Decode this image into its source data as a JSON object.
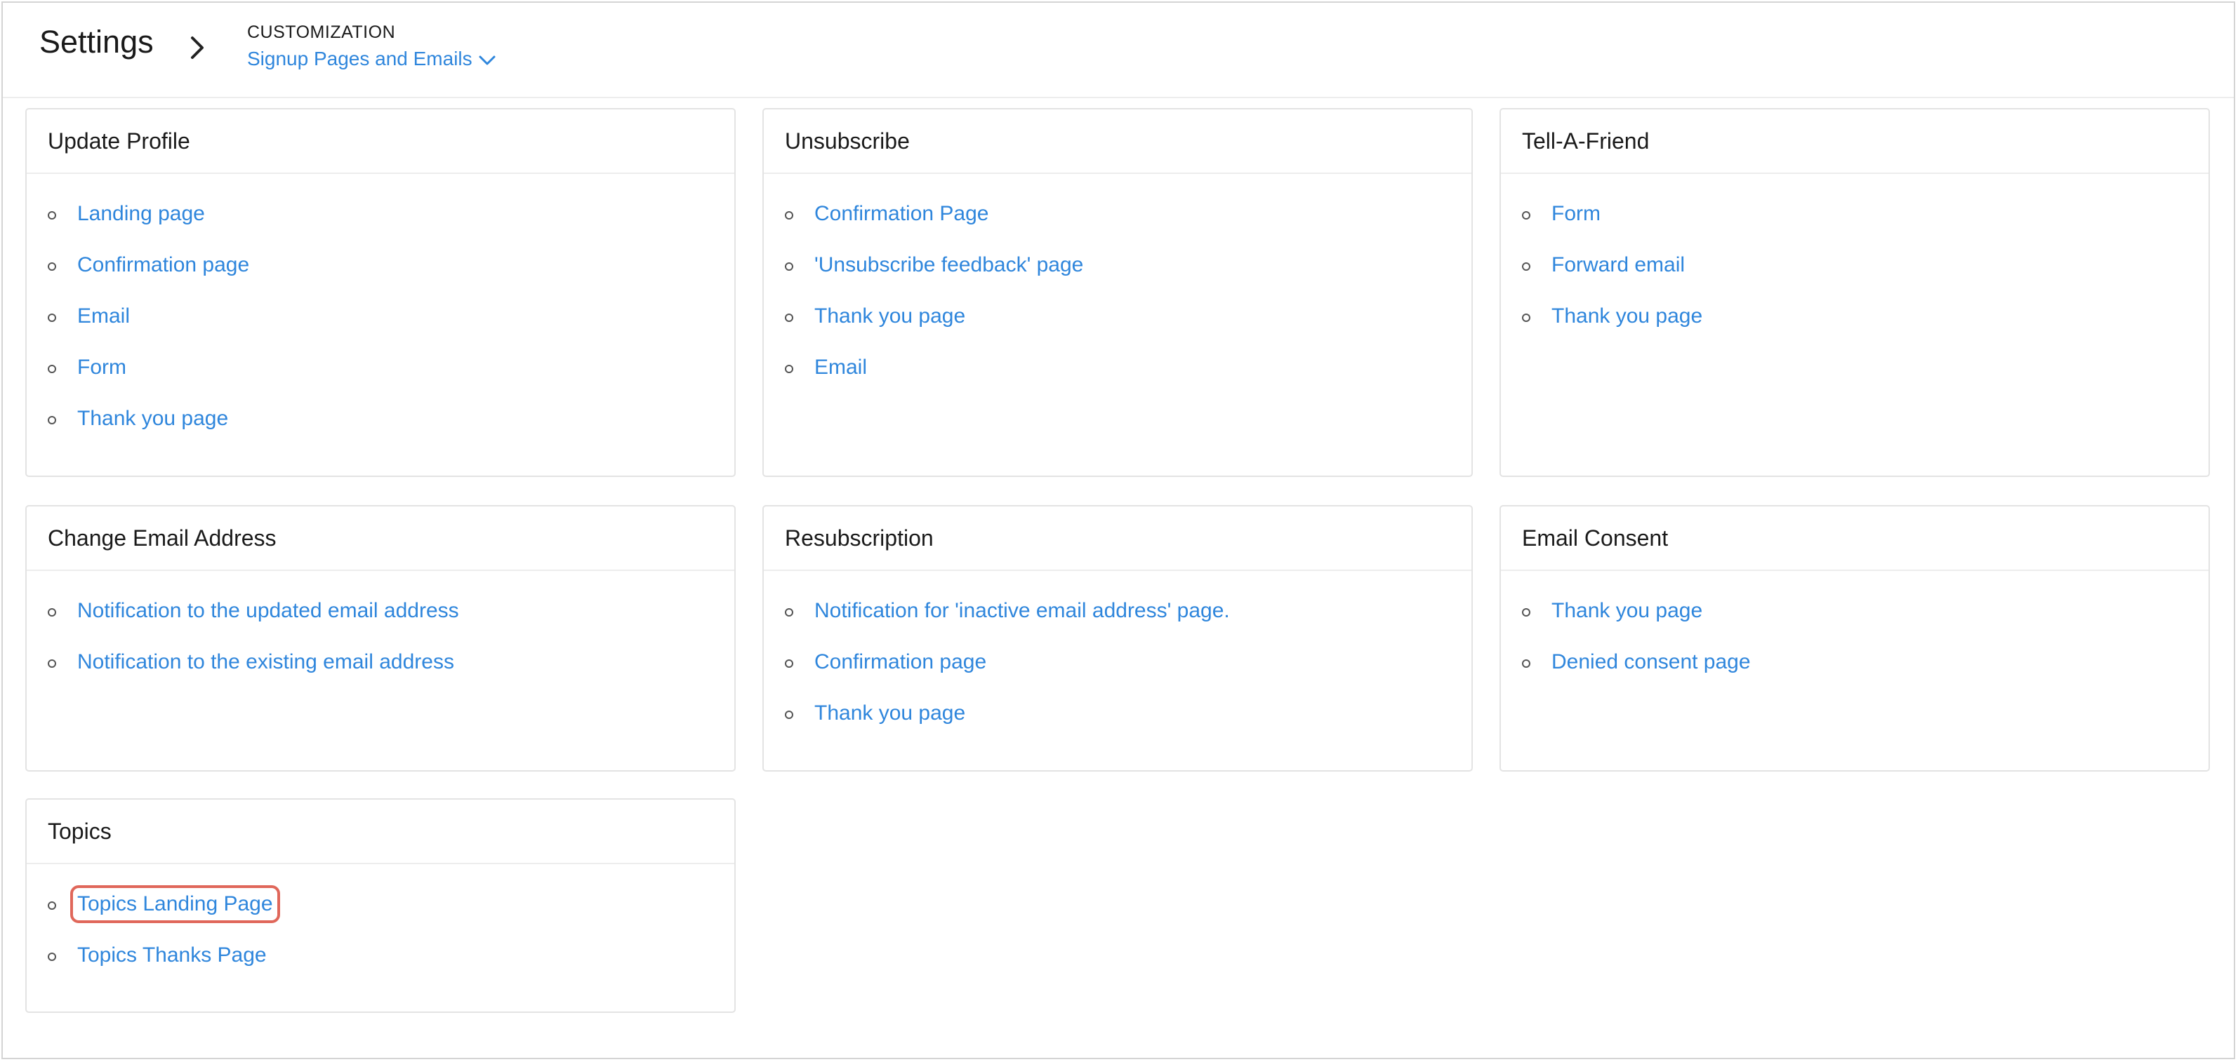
{
  "header": {
    "title": "Settings",
    "breadcrumb_section": "CUSTOMIZATION",
    "breadcrumb_page": "Signup Pages and Emails"
  },
  "cards": [
    {
      "title": "Update Profile",
      "items": [
        "Landing page",
        "Confirmation page",
        "Email",
        "Form",
        "Thank you page"
      ]
    },
    {
      "title": "Unsubscribe",
      "items": [
        "Confirmation Page",
        "'Unsubscribe feedback' page",
        "Thank you page",
        "Email"
      ]
    },
    {
      "title": "Tell-A-Friend",
      "items": [
        "Form",
        "Forward email",
        "Thank you page"
      ]
    },
    {
      "title": "Change Email Address",
      "items": [
        "Notification to the updated email address",
        "Notification to the existing email address"
      ]
    },
    {
      "title": "Resubscription",
      "items": [
        "Notification for 'inactive email address' page.",
        "Confirmation page",
        "Thank you page"
      ]
    },
    {
      "title": "Email Consent",
      "items": [
        "Thank you page",
        "Denied consent page"
      ]
    },
    {
      "title": "Topics",
      "items": [
        "Topics Landing Page",
        "Topics Thanks Page"
      ],
      "highlighted_item": "Topics Landing Page"
    }
  ],
  "colors": {
    "link": "#2f86dc",
    "highlight": "#e0675a",
    "border": "#e3e3e3"
  }
}
